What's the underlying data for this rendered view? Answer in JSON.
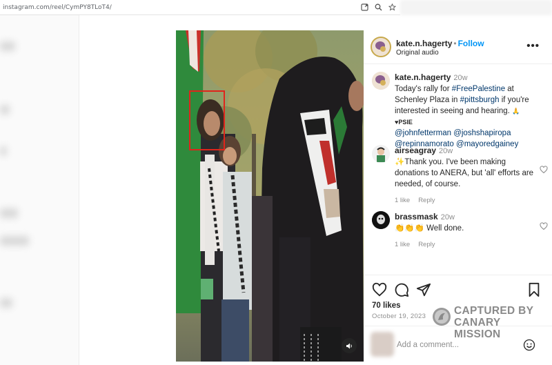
{
  "browser": {
    "url": "instagram.com/reel/CymPY8TLoT4/",
    "icons": [
      "open-in-app-icon",
      "zoom-icon",
      "star-icon"
    ]
  },
  "post": {
    "author": "kate.n.hagerty",
    "follow_label": "Follow",
    "audio": "Original audio",
    "more": "•••",
    "caption": {
      "user": "kate.n.hagerty",
      "time": "20w",
      "text_parts": [
        "Today's rally for ",
        "#FreePalestine",
        " at Schenley Plaza in ",
        "#pittsburgh",
        " if you're interested in seeing and hearing. ",
        "🙏♥PSIE"
      ],
      "mentions": "@johnfetterman @joshshapiropa @repinnamorato @mayoredgainey"
    },
    "comments": [
      {
        "user": "airseagray",
        "time": "20w",
        "text": "✨Thank you. I've been making donations to ANERA, but 'all' efforts are needed, of course.",
        "likes": "1 like",
        "reply": "Reply"
      },
      {
        "user": "brassmask",
        "time": "20w",
        "text": "👏👏👏 Well done.",
        "likes": "1 like",
        "reply": "Reply"
      }
    ],
    "likes": "70 likes",
    "date": "October 19, 2023",
    "add_comment_placeholder": "Add a comment...",
    "sound_icon": "speaker-icon"
  },
  "watermark": {
    "line1": "CAPTURED BY",
    "line2": "CANARY MISSION"
  },
  "colors": {
    "accent": "#0095f6",
    "highlight": "#e0241b"
  }
}
